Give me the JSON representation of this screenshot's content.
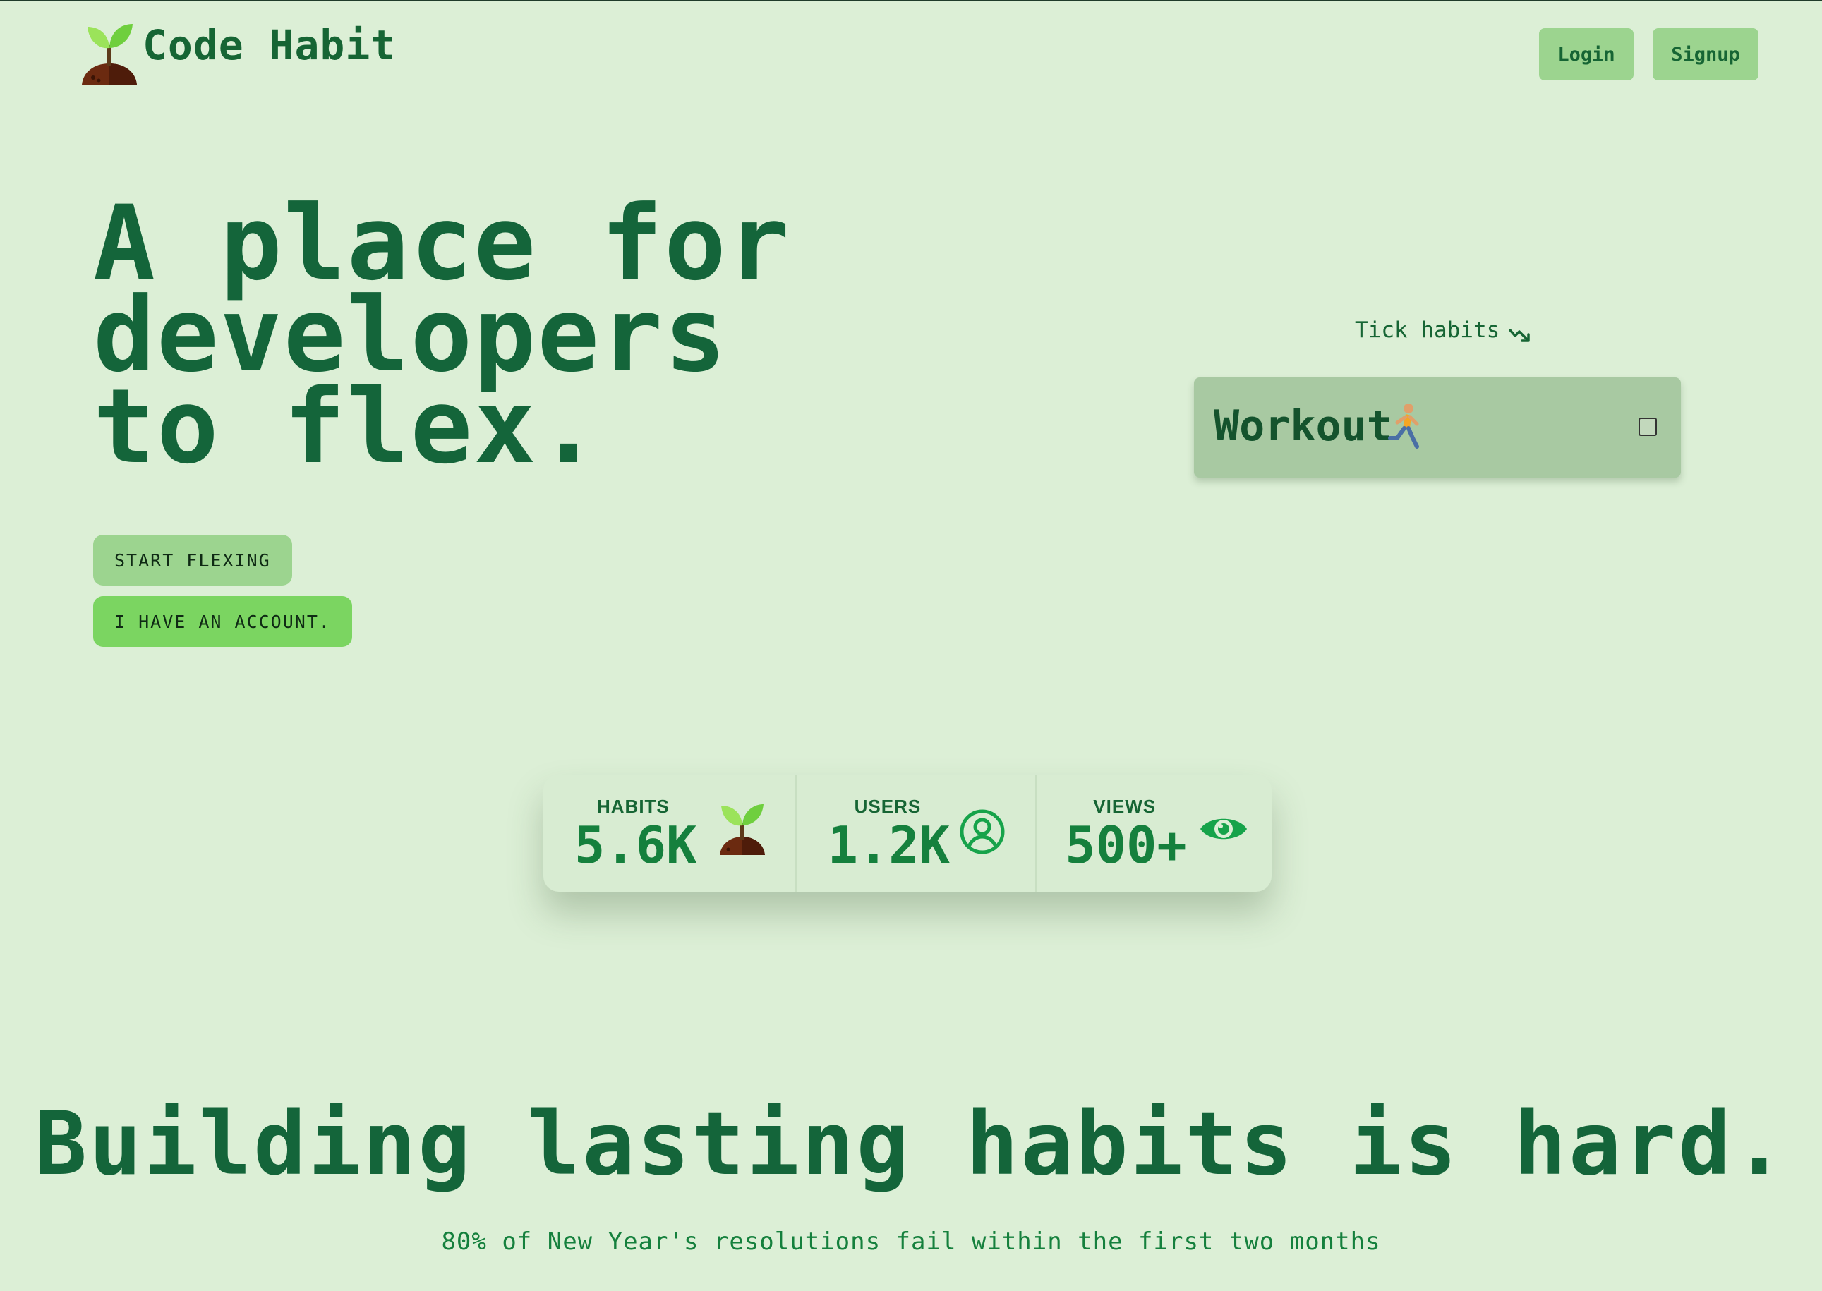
{
  "header": {
    "brand": "Code Habit",
    "login_label": "Login",
    "signup_label": "Signup"
  },
  "hero": {
    "title_lines": [
      "A place for",
      "developers",
      "to flex."
    ],
    "start_label": "START FLEXING",
    "account_label": "I HAVE AN ACCOUNT."
  },
  "demo": {
    "hint": "Tick habits",
    "habit_name": "Workout",
    "habit_icon": "runner-icon",
    "checked": false
  },
  "stats": [
    {
      "label": "HABITS",
      "value": "5.6K",
      "icon": "sprout-icon"
    },
    {
      "label": "USERS",
      "value": "1.2K",
      "icon": "user-circle-icon"
    },
    {
      "label": "VIEWS",
      "value": "500+",
      "icon": "eye-icon"
    }
  ],
  "section": {
    "title": "Building lasting habits is hard.",
    "subtitle": "80% of New Year's resolutions fail within the first two months"
  },
  "colors": {
    "background": "#dcefd6",
    "primary_text": "#166534",
    "button": "#9cd48f",
    "button_accent": "#7bd561",
    "card": "#a8c9a2"
  }
}
